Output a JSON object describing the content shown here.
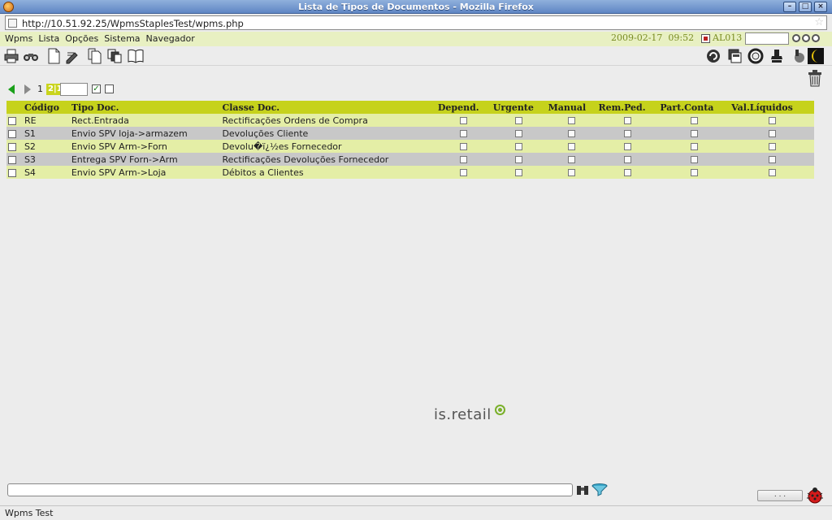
{
  "window": {
    "title": "Lista de Tipos de Documentos - Mozilla Firefox",
    "min_label": "–",
    "max_label": "□",
    "close_label": "×"
  },
  "browser": {
    "url": "http://10.51.92.25/WpmsStaplesTest/wpms.php",
    "status": "Wpms Test"
  },
  "menu": {
    "items": [
      "Wpms",
      "Lista",
      "Opções",
      "Sistema",
      "Navegador"
    ]
  },
  "session": {
    "date": "2009-02-17",
    "time": "09:52",
    "user": "AL013"
  },
  "toolbar": {
    "left_icons": [
      "printer-icon",
      "binoculars-icon",
      "new-document-icon",
      "edit-icon",
      "copy-icon",
      "multi-copy-icon",
      "book-icon"
    ],
    "right_icons": [
      "refresh-icon",
      "save-icon",
      "lifebuoy-icon",
      "stamp-icon",
      "tools-icon",
      "moon-icon"
    ]
  },
  "pager": {
    "current": "1",
    "total": "2|1",
    "check_mark": "✓"
  },
  "table": {
    "columns": [
      "Código",
      "Tipo Doc.",
      "Classe Doc.",
      "Depend.",
      "Urgente",
      "Manual",
      "Rem.Ped.",
      "Part.Conta",
      "Val.Líquidos"
    ],
    "rows": [
      {
        "codigo": "RE",
        "tipo": "Rect.Entrada",
        "classe": "Rectificações Ordens de Compra"
      },
      {
        "codigo": "S1",
        "tipo": "Envio SPV loja->armazem",
        "classe": "Devoluções Cliente"
      },
      {
        "codigo": "S2",
        "tipo": "Envio SPV Arm->Forn",
        "classe": "Devolu�ï¿½es Fornecedor"
      },
      {
        "codigo": "S3",
        "tipo": "Entrega SPV Forn->Arm",
        "classe": "Rectificações Devoluções Fornecedor"
      },
      {
        "codigo": "S4",
        "tipo": "Envio SPV Arm->Loja",
        "classe": "Débitos a Clientes"
      }
    ]
  },
  "logo": {
    "text": "is.retail"
  },
  "footer": {
    "dots_button": ". . ."
  },
  "colors": {
    "header": "#c6d21c",
    "row_odd": "#e4eea6",
    "row_even": "#c8c8c8",
    "accent_text": "#7a8c24"
  }
}
